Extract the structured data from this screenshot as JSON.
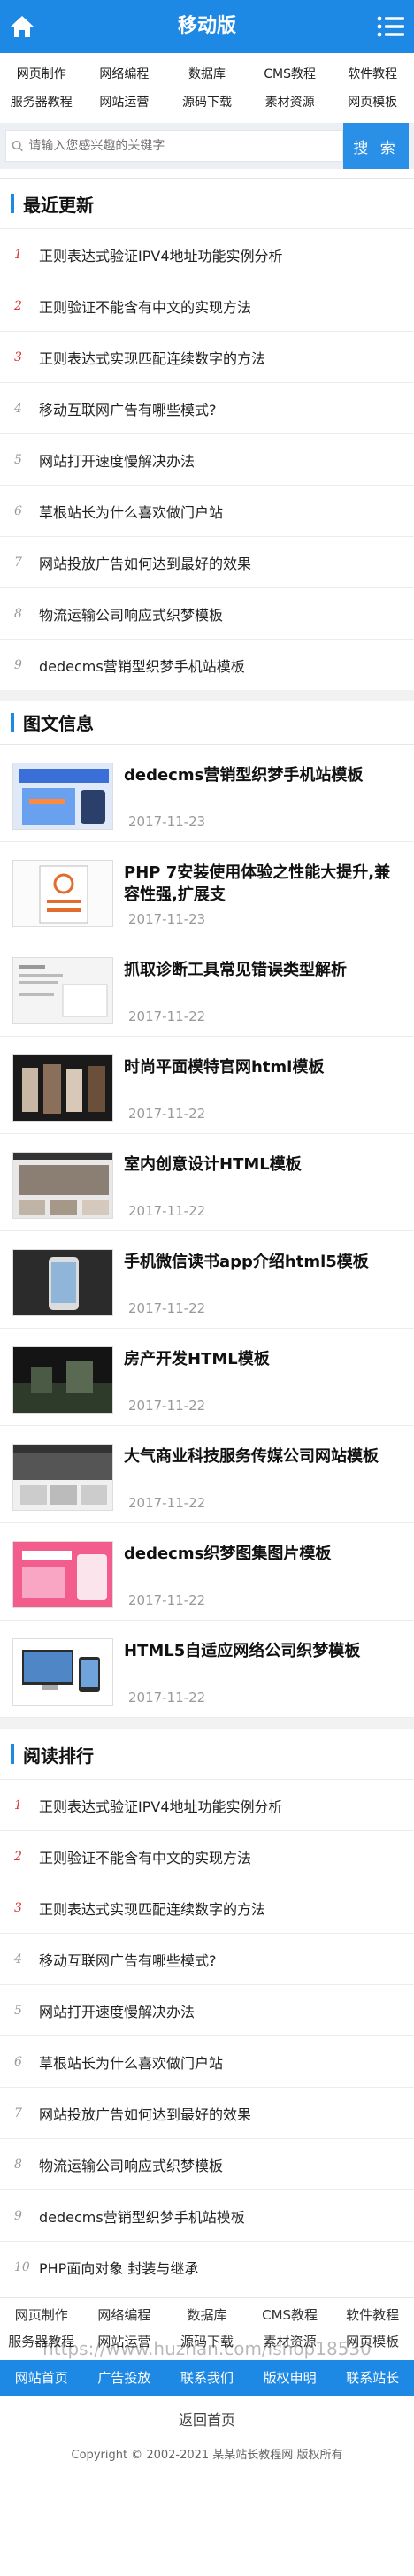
{
  "header": {
    "title": "移动版"
  },
  "nav": [
    "网页制作",
    "网络编程",
    "数据库",
    "CMS教程",
    "软件教程",
    "服务器教程",
    "网站运营",
    "源码下载",
    "素材资源",
    "网页模板"
  ],
  "search": {
    "placeholder": "请输入您感兴趣的关键字",
    "button": "搜 索"
  },
  "latest": {
    "title": "最近更新",
    "items": [
      {
        "n": "1",
        "t": "正则表达式验证IPV4地址功能实例分析"
      },
      {
        "n": "2",
        "t": "正则验证不能含有中文的实现方法"
      },
      {
        "n": "3",
        "t": "正则表达式实现匹配连续数字的方法"
      },
      {
        "n": "4",
        "t": "移动互联网广告有哪些模式?"
      },
      {
        "n": "5",
        "t": "网站打开速度慢解决办法"
      },
      {
        "n": "6",
        "t": "草根站长为什么喜欢做门户站"
      },
      {
        "n": "7",
        "t": "网站投放广告如何达到最好的效果"
      },
      {
        "n": "8",
        "t": "物流运输公司响应式织梦模板"
      },
      {
        "n": "9",
        "t": "dedecms营销型织梦手机站模板"
      }
    ]
  },
  "images": {
    "title": "图文信息",
    "items": [
      {
        "t": "dedecms营销型织梦手机站模板",
        "d": "2017-11-23"
      },
      {
        "t": "PHP 7安装使用体验之性能大提升,兼容性强,扩展支",
        "d": "2017-11-23"
      },
      {
        "t": "抓取诊断工具常见错误类型解析",
        "d": "2017-11-22"
      },
      {
        "t": "时尚平面模特官网html模板",
        "d": "2017-11-22"
      },
      {
        "t": "室内创意设计HTML模板",
        "d": "2017-11-22"
      },
      {
        "t": "手机微信读书app介绍html5模板",
        "d": "2017-11-22"
      },
      {
        "t": "房产开发HTML模板",
        "d": "2017-11-22"
      },
      {
        "t": "大气商业科技服务传媒公司网站模板",
        "d": "2017-11-22"
      },
      {
        "t": "dedecms织梦图集图片模板",
        "d": "2017-11-22"
      },
      {
        "t": "HTML5自适应网络公司织梦模板",
        "d": "2017-11-22"
      }
    ]
  },
  "ranking": {
    "title": "阅读排行",
    "items": [
      {
        "n": "1",
        "t": "正则表达式验证IPV4地址功能实例分析"
      },
      {
        "n": "2",
        "t": "正则验证不能含有中文的实现方法"
      },
      {
        "n": "3",
        "t": "正则表达式实现匹配连续数字的方法"
      },
      {
        "n": "4",
        "t": "移动互联网广告有哪些模式?"
      },
      {
        "n": "5",
        "t": "网站打开速度慢解决办法"
      },
      {
        "n": "6",
        "t": "草根站长为什么喜欢做门户站"
      },
      {
        "n": "7",
        "t": "网站投放广告如何达到最好的效果"
      },
      {
        "n": "8",
        "t": "物流运输公司响应式织梦模板"
      },
      {
        "n": "9",
        "t": "dedecms营销型织梦手机站模板"
      },
      {
        "n": "10",
        "t": "PHP面向对象 封装与继承"
      }
    ]
  },
  "footer": {
    "nav": [
      "网页制作",
      "网络编程",
      "数据库",
      "CMS教程",
      "软件教程",
      "服务器教程",
      "网站运营",
      "源码下载",
      "素材资源",
      "网页模板"
    ],
    "links": [
      "网站首页",
      "广告投放",
      "联系我们",
      "版权申明",
      "联系站长"
    ],
    "back": "返回首页",
    "copyright": "Copyright © 2002-2021 某某站长教程网 版权所有"
  },
  "watermark": "https://www.huzhan.com/ishop18530",
  "colors": {
    "brand": "#1e88e5",
    "accent_num": "#dd3333"
  }
}
